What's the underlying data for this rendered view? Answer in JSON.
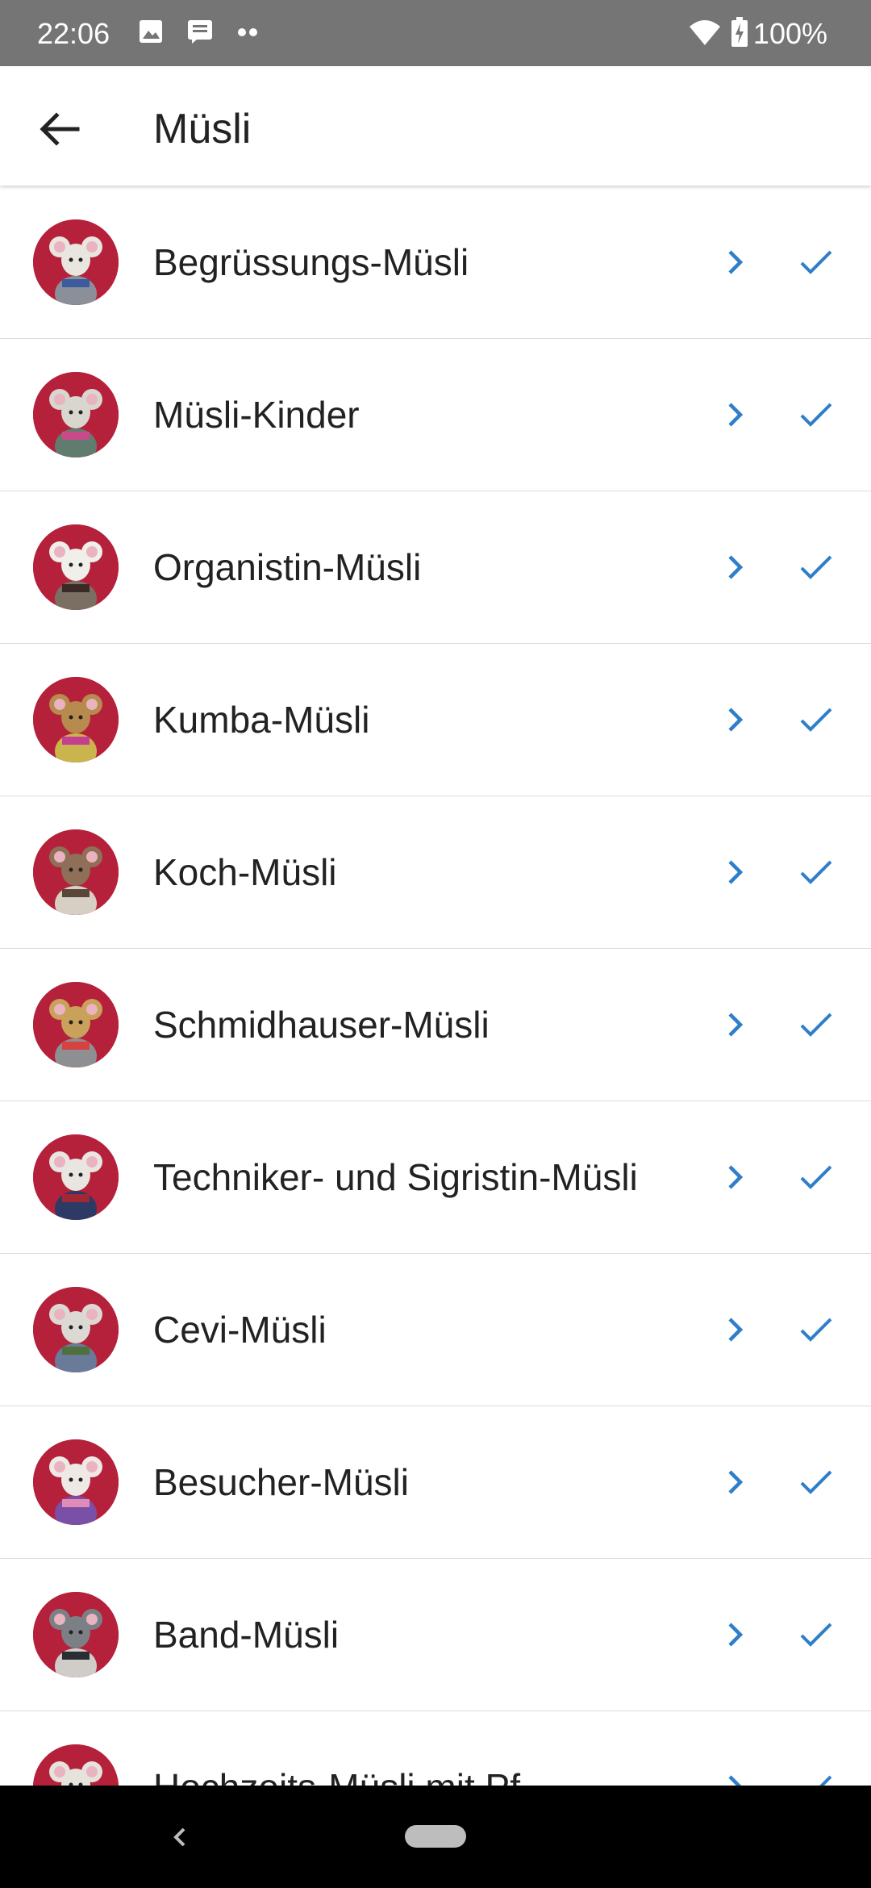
{
  "status_bar": {
    "time": "22:06",
    "icons": [
      "image-icon",
      "message-icon",
      "more-dots-icon",
      "wifi-icon",
      "battery-charging-icon"
    ],
    "battery": "100%"
  },
  "app_bar": {
    "back_icon": "arrow-back-icon",
    "title": "Müsli"
  },
  "colors": {
    "accent": "#2f7ec9",
    "avatar_background": "#b5213a",
    "status_bar": "#757575"
  },
  "items": [
    {
      "label": "Begrüssungs-Müsli"
    },
    {
      "label": "Müsli-Kinder"
    },
    {
      "label": "Organistin-Müsli"
    },
    {
      "label": "Kumba-Müsli"
    },
    {
      "label": "Koch-Müsli"
    },
    {
      "label": "Schmidhauser-Müsli"
    },
    {
      "label": "Techniker- und Sigristin-Müsli"
    },
    {
      "label": "Cevi-Müsli"
    },
    {
      "label": "Besucher-Müsli"
    },
    {
      "label": "Band-Müsli"
    },
    {
      "label": "Hochzeits-Müsli mit Pf"
    }
  ]
}
